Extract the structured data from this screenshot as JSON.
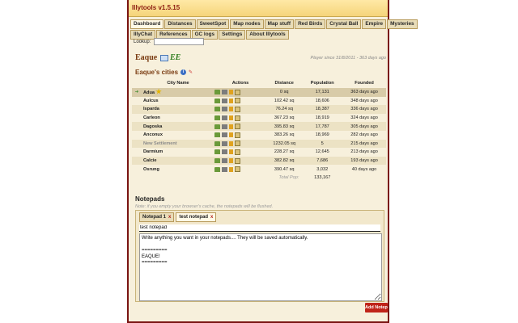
{
  "app": {
    "title": "Illytools v1.5.15"
  },
  "tabs": {
    "row1": [
      "Dashboard",
      "Distances",
      "SweetSpot",
      "Map nodes",
      "Map stuff",
      "Red Birds",
      "Crystal Ball",
      "Empire",
      "Mysteries"
    ],
    "row2": [
      "IllyChat",
      "References",
      "GC logs",
      "Settings",
      "About Illytools"
    ],
    "active": "Dashboard"
  },
  "lookup": {
    "label": "Lookup:",
    "value": ""
  },
  "player": {
    "name": "Eaque",
    "alliance": "EE",
    "since": "Player since 31/8/2011 - 363 days ago"
  },
  "cities": {
    "title": "Eaque's cities",
    "headers": {
      "name": "City Name",
      "actions": "Actions",
      "distance": "Distance",
      "population": "Population",
      "founded": "Founded"
    },
    "rows": [
      {
        "name": "Adua",
        "distance": "0 sq",
        "population": "17,131",
        "founded": "363 days ago"
      },
      {
        "name": "Aulcus",
        "distance": "102.42 sq",
        "population": "18,606",
        "founded": "348 days ago"
      },
      {
        "name": "Isparda",
        "distance": "76.24 sq",
        "population": "18,387",
        "founded": "336 days ago"
      },
      {
        "name": "Carleon",
        "distance": "367.23 sq",
        "population": "18,919",
        "founded": "324 days ago"
      },
      {
        "name": "Dagoska",
        "distance": "395.83 sq",
        "population": "17,787",
        "founded": "305 days ago"
      },
      {
        "name": "Anconux",
        "distance": "383.26 sq",
        "population": "18,969",
        "founded": "282 days ago"
      },
      {
        "name": "New Settlement",
        "distance": "1232.05 sq",
        "population": "5",
        "founded": "215 days ago"
      },
      {
        "name": "Darmium",
        "distance": "228.27 sq",
        "population": "12,645",
        "founded": "213 days ago"
      },
      {
        "name": "Calcie",
        "distance": "382.82 sq",
        "population": "7,686",
        "founded": "193 days ago"
      },
      {
        "name": "Osrung",
        "distance": "390.47 sq",
        "population": "3,032",
        "founded": "40 days ago"
      }
    ],
    "total_label": "Total Pop:",
    "total_value": "133,167"
  },
  "notepads": {
    "title": "Notepads",
    "note": "Note: if you empty your browser's cache, the notepads will be flushed.",
    "tabs": [
      {
        "label": "Notepad 1",
        "close": "x"
      },
      {
        "label": "test notepad",
        "close": "x"
      }
    ],
    "active_index": 1,
    "current_name": "test notepad",
    "current_content": "Write anything you want in your notepads.... They will be saved automatically.\n\n=========\nEAQUE!\n=========",
    "add_button": "Add Notepad"
  },
  "colors": {
    "accent": "#7a1412",
    "button": "#c0241a",
    "brand": "#8b1a10"
  }
}
